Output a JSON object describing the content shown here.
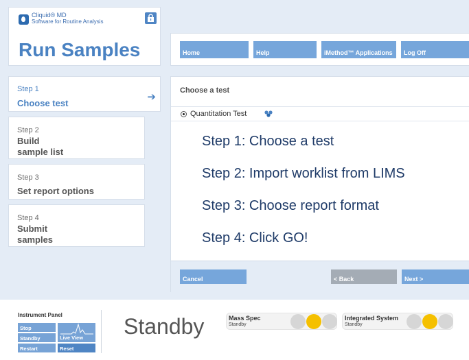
{
  "app": {
    "name": "Cliquid® MD",
    "subtitle": "Software for Routine Analysis",
    "page_title": "Run Samples"
  },
  "nav": {
    "items": [
      "Home",
      "Help",
      "iMethod™ Applications",
      "Log Off"
    ]
  },
  "steps": [
    {
      "num": "Step 1",
      "label": "Choose test"
    },
    {
      "num": "Step 2",
      "label": "Build\nsample list"
    },
    {
      "num": "Step 3",
      "label": "Set report options"
    },
    {
      "num": "Step 4",
      "label": "Submit\nsamples"
    }
  ],
  "main": {
    "heading": "Choose a test",
    "test_option": "Quantitation Test",
    "instructions": [
      "Step 1: Choose a test",
      "Step 2: Import worklist from LIMS",
      "Step 3: Choose report format",
      "Step 4: Click GO!"
    ],
    "buttons": {
      "cancel": "Cancel",
      "back": "< Back",
      "next": "Next >"
    }
  },
  "instrument_panel": {
    "title": "Instrument Panel",
    "stop": "Stop",
    "standby": "Standby",
    "live_view": "Live View",
    "restart": "Restart",
    "reset": "Reset",
    "state": "Standby"
  },
  "status": [
    {
      "title": "Mass Spec",
      "state": "Standby",
      "active_light": 2
    },
    {
      "title": "Integrated System",
      "state": "Standby",
      "active_light": 2
    }
  ],
  "colors": {
    "accent": "#4a82c2",
    "nav_button": "#76a6db",
    "back_button": "#a4acb5",
    "status_on": "#f5c000",
    "status_off": "#d6d6d6"
  }
}
